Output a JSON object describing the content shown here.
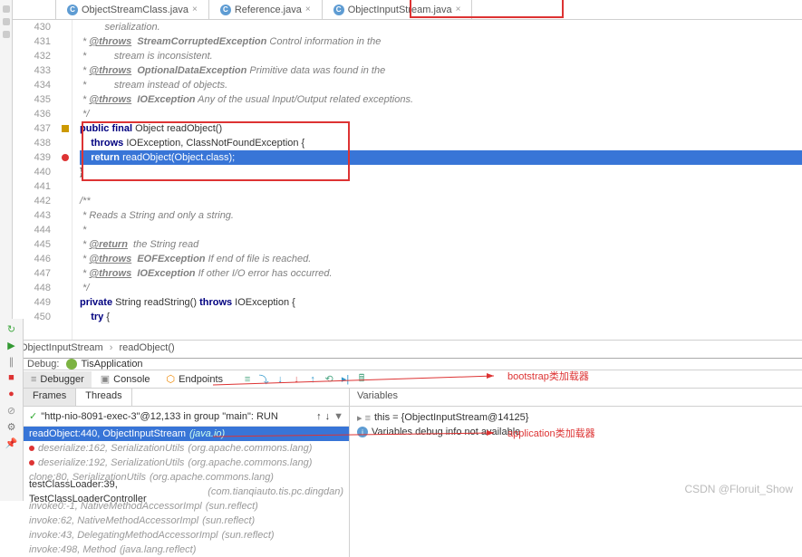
{
  "tabs": [
    {
      "label": "ObjectStreamClass.java",
      "active": false
    },
    {
      "label": "Reference.java",
      "active": false
    },
    {
      "label": "ObjectInputStream.java",
      "active": true
    }
  ],
  "code": {
    "start": 430,
    "lines": [
      {
        "n": 430,
        "kind": "cm",
        "text": "         serialization."
      },
      {
        "n": 431,
        "kind": "cm",
        "text": " * @throws  StreamCorruptedException Control information in the"
      },
      {
        "n": 432,
        "kind": "cm",
        "text": " *          stream is inconsistent."
      },
      {
        "n": 433,
        "kind": "cm",
        "text": " * @throws  OptionalDataException Primitive data was found in the"
      },
      {
        "n": 434,
        "kind": "cm",
        "text": " *          stream instead of objects."
      },
      {
        "n": 435,
        "kind": "cm",
        "text": " * @throws  IOException Any of the usual Input/Output related exceptions."
      },
      {
        "n": 436,
        "kind": "cm",
        "text": " */"
      },
      {
        "n": 437,
        "kind": "code",
        "text": "public final Object readObject()",
        "marker": "gm"
      },
      {
        "n": 438,
        "kind": "code",
        "text": "    throws IOException, ClassNotFoundException {"
      },
      {
        "n": 439,
        "kind": "code",
        "text": "    return readObject(Object.class);",
        "sel": true,
        "marker": "bp"
      },
      {
        "n": 440,
        "kind": "code",
        "text": "}"
      },
      {
        "n": 441,
        "kind": "blank",
        "text": ""
      },
      {
        "n": 442,
        "kind": "cm",
        "text": "/**"
      },
      {
        "n": 443,
        "kind": "cm",
        "text": " * Reads a String and only a string."
      },
      {
        "n": 444,
        "kind": "cm",
        "text": " *"
      },
      {
        "n": 445,
        "kind": "cm",
        "text": " * @return  the String read"
      },
      {
        "n": 446,
        "kind": "cm",
        "text": " * @throws  EOFException If end of file is reached."
      },
      {
        "n": 447,
        "kind": "cm",
        "text": " * @throws  IOException If other I/O error has occurred."
      },
      {
        "n": 448,
        "kind": "cm",
        "text": " */"
      },
      {
        "n": 449,
        "kind": "code",
        "text": "private String readString() throws IOException {"
      },
      {
        "n": 450,
        "kind": "code",
        "text": "    try {"
      }
    ]
  },
  "breadcrumb": {
    "class": "ObjectInputStream",
    "method": "readObject()"
  },
  "debug": {
    "label": "Debug:",
    "config": "TisApplication",
    "tabs": {
      "debugger": "Debugger",
      "console": "Console",
      "endpoints": "Endpoints"
    },
    "frames_tab": "Frames",
    "threads_tab": "Threads",
    "thread": "\"http-nio-8091-exec-3\"@12,133 in group \"main\": RUN",
    "vars_header": "Variables",
    "frames": [
      {
        "text": "readObject:440, ObjectInputStream",
        "lib": "(java.io)",
        "sel": true
      },
      {
        "text": "deserialize:162, SerializationUtils",
        "lib": "(org.apache.commons.lang)",
        "yellow": true,
        "dot": true
      },
      {
        "text": "deserialize:192, SerializationUtils",
        "lib": "(org.apache.commons.lang)",
        "yellow": true,
        "dot": true
      },
      {
        "text": "clone:80, SerializationUtils",
        "lib": "(org.apache.commons.lang)",
        "yellow": true
      },
      {
        "text": "testClassLoader:39, TestClassLoaderController",
        "lib": "(com.tianqiauto.tis.pc.dingdan)"
      },
      {
        "text": "invoke0:-1, NativeMethodAccessorImpl",
        "lib": "(sun.reflect)",
        "yellow": true
      },
      {
        "text": "invoke:62, NativeMethodAccessorImpl",
        "lib": "(sun.reflect)",
        "yellow": true
      },
      {
        "text": "invoke:43, DelegatingMethodAccessorImpl",
        "lib": "(sun.reflect)",
        "yellow": true
      },
      {
        "text": "invoke:498, Method",
        "lib": "(java.lang.reflect)",
        "yellow": true
      }
    ],
    "vars": [
      {
        "icon": "obj",
        "text": "this = {ObjectInputStream@14125}"
      },
      {
        "icon": "info",
        "text": "Variables debug info not available"
      }
    ]
  },
  "annotations": {
    "bootstrap": "bootstrap类加载器",
    "application": "application类加载器"
  },
  "watermark": "CSDN @Floruit_Show"
}
